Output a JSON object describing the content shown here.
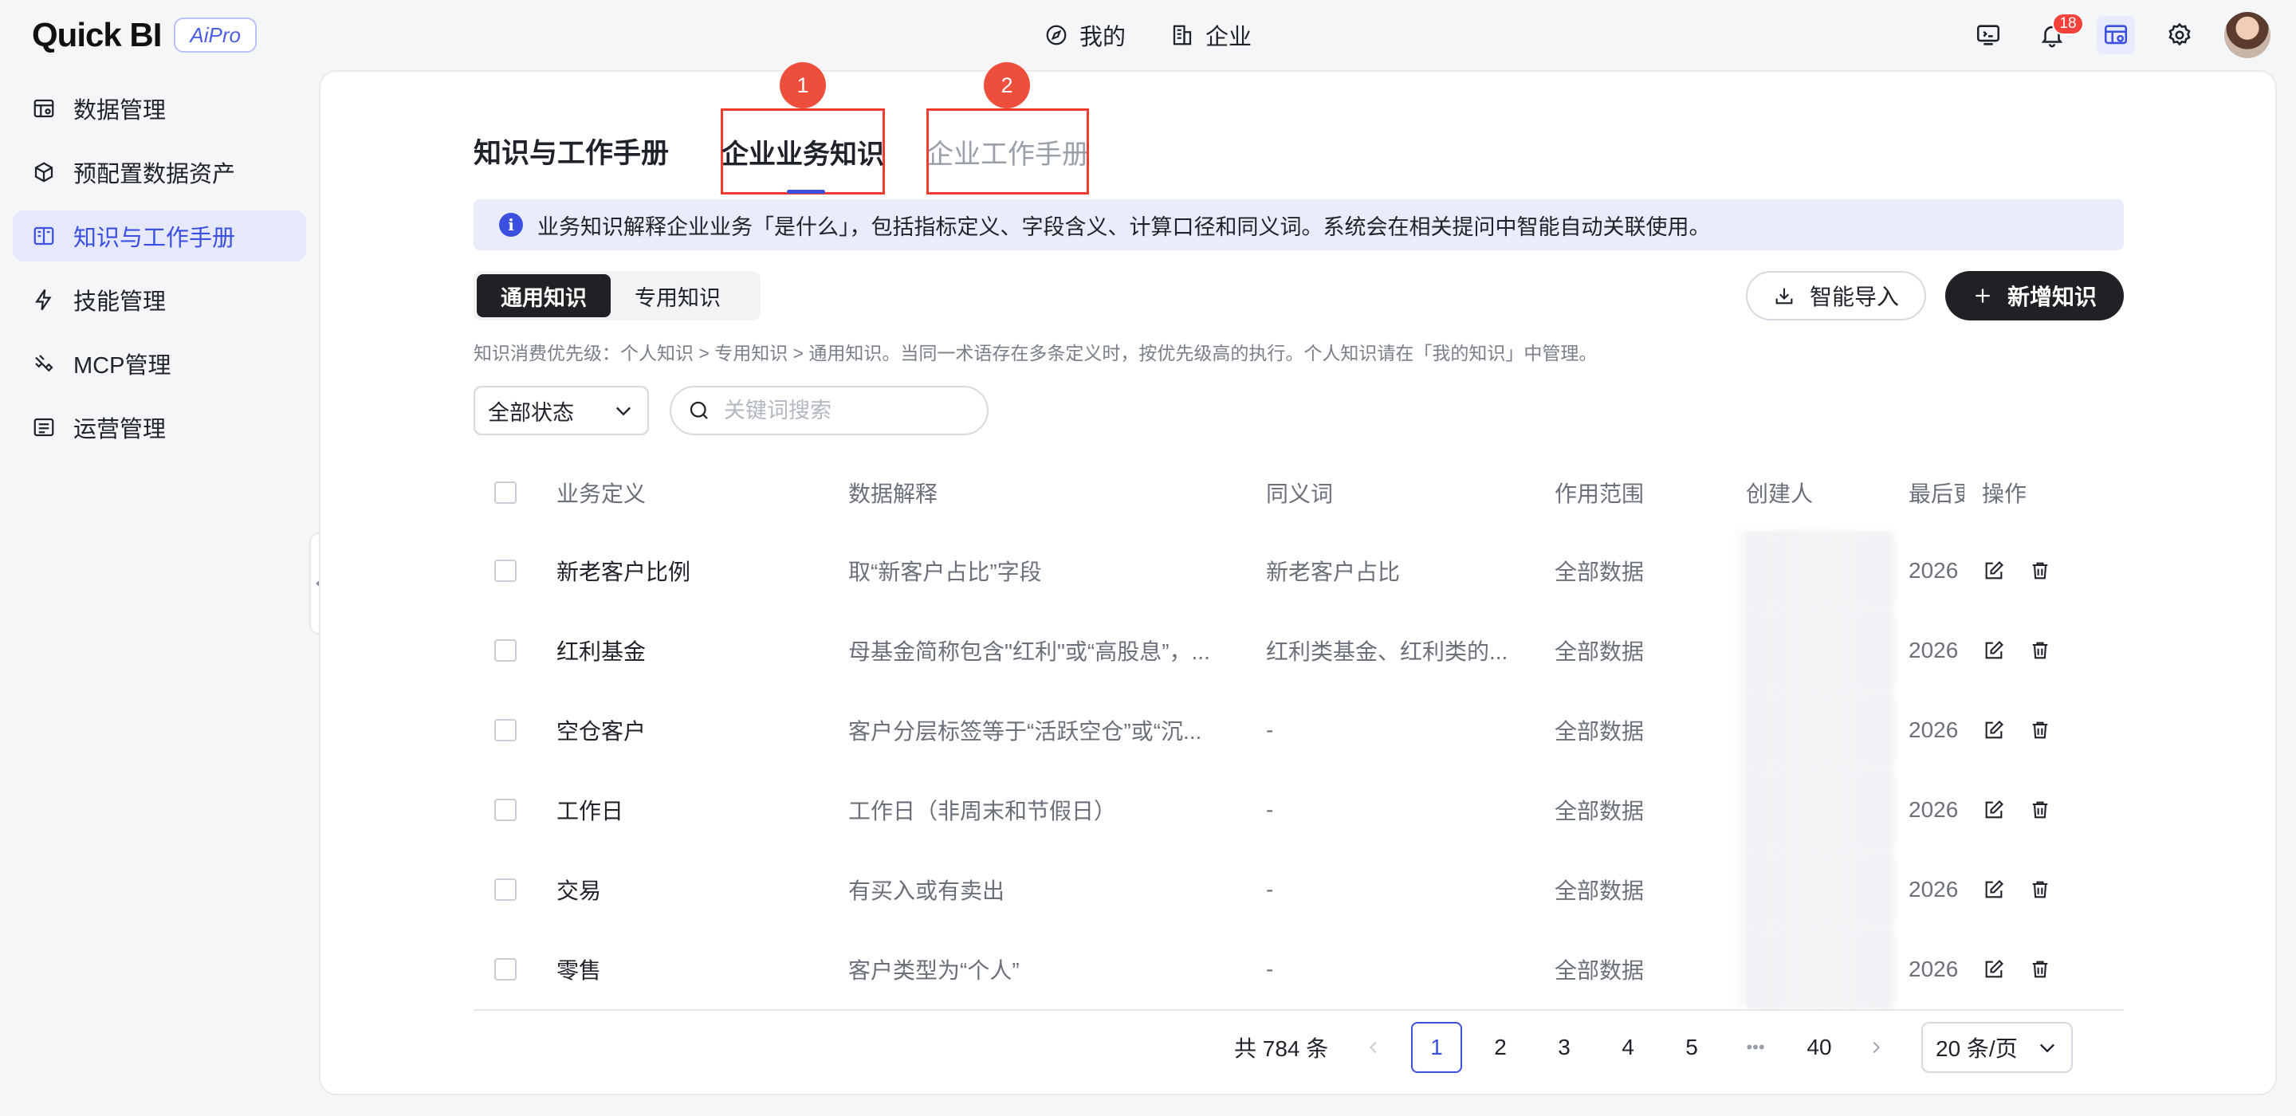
{
  "app": {
    "logo_text": "Quick BI",
    "logo_badge": "AiPro"
  },
  "topnav": [
    {
      "label": "我的",
      "icon": "compass-icon"
    },
    {
      "label": "企业",
      "icon": "building-icon"
    }
  ],
  "top_actions": {
    "notification_count": "18"
  },
  "sidebar": {
    "items": [
      {
        "label": "数据管理",
        "icon": "table-icon"
      },
      {
        "label": "预配置数据资产",
        "icon": "cube-icon"
      },
      {
        "label": "知识与工作手册",
        "icon": "book-icon",
        "active": true
      },
      {
        "label": "技能管理",
        "icon": "lightning-icon"
      },
      {
        "label": "MCP管理",
        "icon": "link-icon"
      },
      {
        "label": "运营管理",
        "icon": "list-icon"
      }
    ]
  },
  "page": {
    "title": "知识与工作手册",
    "tabs": [
      {
        "label": "企业业务知识",
        "step": "1"
      },
      {
        "label": "企业工作手册",
        "step": "2"
      }
    ],
    "info_text": "业务知识解释企业业务「是什么」，包括指标定义、字段含义、计算口径和同义词。系统会在相关提问中智能自动关联使用。",
    "segments": [
      "通用知识",
      "专用知识"
    ],
    "import_label": "智能导入",
    "add_label": "新增知识",
    "priority_note": "知识消费优先级：个人知识 > 专用知识 > 通用知识。当同一术语存在多条定义时，按优先级高的执行。个人知识请在「我的知识」中管理。",
    "status_filter": "全部状态",
    "search_placeholder": "关键词搜索"
  },
  "table": {
    "headers": {
      "definition": "业务定义",
      "explanation": "数据解释",
      "synonyms": "同义词",
      "scope": "作用范围",
      "creator": "创建人",
      "updated": "最后更新",
      "ops": "操作"
    },
    "rows": [
      {
        "definition": "新老客户比例",
        "explanation": "取“新客户占比”字段",
        "synonyms": "新老客户占比",
        "scope": "全部数据",
        "updated": "2026"
      },
      {
        "definition": "红利基金",
        "explanation": "母基金简称包含\"红利\"或“高股息”，...",
        "synonyms": "红利类基金、红利类的...",
        "scope": "全部数据",
        "updated": "2026"
      },
      {
        "definition": "空仓客户",
        "explanation": "客户分层标签等于“活跃空仓”或“沉...",
        "synonyms": "-",
        "scope": "全部数据",
        "updated": "2026"
      },
      {
        "definition": "工作日",
        "explanation": "工作日（非周末和节假日）",
        "synonyms": "-",
        "scope": "全部数据",
        "updated": "2026"
      },
      {
        "definition": "交易",
        "explanation": "有买入或有卖出",
        "synonyms": "-",
        "scope": "全部数据",
        "updated": "2026"
      },
      {
        "definition": "零售",
        "explanation": "客户类型为“个人”",
        "synonyms": "-",
        "scope": "全部数据",
        "updated": "2026"
      }
    ]
  },
  "pagination": {
    "total": "共 784 条",
    "pages": [
      "1",
      "2",
      "3",
      "4",
      "5"
    ],
    "ellipsis": "•••",
    "last_page": "40",
    "current": "1",
    "page_size": "20 条/页"
  },
  "colors": {
    "accent": "#3b4fe0",
    "highlight_border": "#f03b2f",
    "step_badge": "#ee4f3c",
    "primary_button": "#1f2125"
  }
}
